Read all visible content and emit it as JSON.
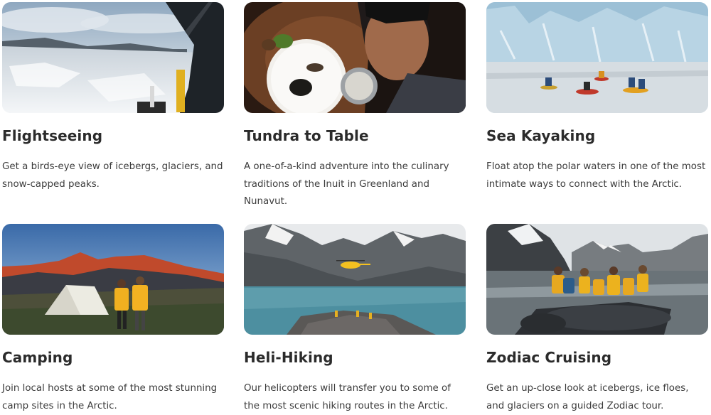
{
  "activities": [
    {
      "title": "Flightseeing",
      "description": "Get a birds-eye view of icebergs, glaciers, and snow-capped peaks.",
      "image": "helicopter-window-glacier-view"
    },
    {
      "title": "Tundra to Table",
      "description": "A one-of-a-kind adventure into the culinary traditions of the Inuit in Greenland and Nunavut.",
      "image": "person-tasting-food-plate"
    },
    {
      "title": "Sea Kayaking",
      "description": "Float atop the polar waters in one of the most intimate ways to connect with the Arctic.",
      "image": "kayakers-near-glacier"
    },
    {
      "title": "Camping",
      "description": "Join local hosts at some of the most stunning camp sites in the Arctic.",
      "image": "tent-and-hikers-mountains"
    },
    {
      "title": "Heli-Hiking",
      "description": "Our helicopters will transfer you to some of the most scenic hiking routes in the Arctic.",
      "image": "helicopter-over-fjord"
    },
    {
      "title": "Zodiac Cruising",
      "description": "Get an up-close look at icebergs, ice floes, and glaciers on a guided Zodiac tour.",
      "image": "zodiac-boat-passengers"
    }
  ]
}
